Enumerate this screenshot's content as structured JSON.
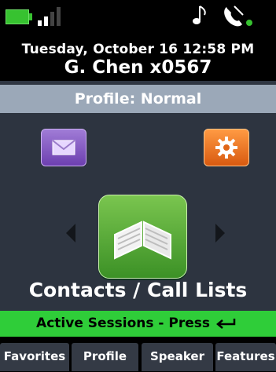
{
  "status": {
    "battery_icon": "battery-full-icon",
    "signal_icon": "signal-strength-icon",
    "ringer_icon": "music-note-icon",
    "line_icon": "phone-registered-icon",
    "accent_color": "#37c230"
  },
  "header": {
    "datetime": "Tuesday, October 16 12:58 PM",
    "user": "G. Chen x0567"
  },
  "profile": {
    "label": "Profile: Normal"
  },
  "main": {
    "left_icon": "mail-icon",
    "right_icon": "gear-icon",
    "selected_app_icon": "open-book-icon",
    "selected_app_label": "Contacts / Call Lists"
  },
  "sessions": {
    "label": "Active Sessions - Press",
    "icon": "enter-icon"
  },
  "softkeys": [
    {
      "label": "Favorites"
    },
    {
      "label": "Profile"
    },
    {
      "label": "Speaker"
    },
    {
      "label": "Features"
    }
  ]
}
